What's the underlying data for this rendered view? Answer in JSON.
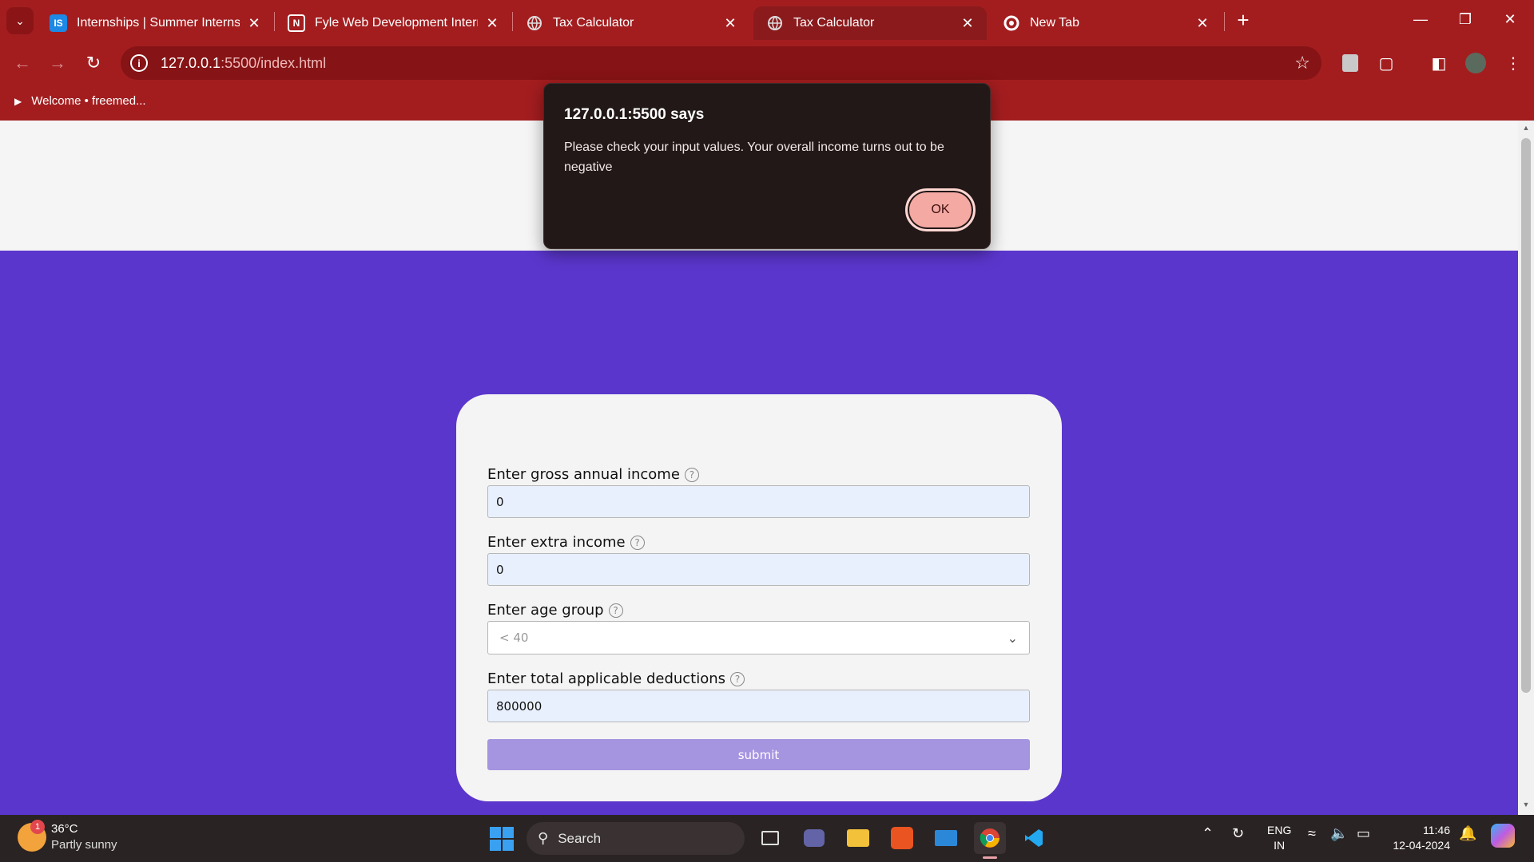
{
  "browser": {
    "tabs": [
      {
        "title": "Internships | Summer Internship",
        "favicon": "IS"
      },
      {
        "title": "Fyle Web Development Internship",
        "favicon": "N"
      },
      {
        "title": "Tax Calculator",
        "favicon": "globe-icon"
      },
      {
        "title": "Tax Calculator",
        "favicon": "globe-icon"
      },
      {
        "title": "New Tab",
        "favicon": "chrome-icon"
      }
    ],
    "active_tab_index": 3,
    "url_host": "127.0.0.1",
    "url_rest": ":5500/index.html",
    "bookmark": "Welcome • freemed...",
    "accent_color": "#a31d1f"
  },
  "dialog": {
    "title": "127.0.0.1:5500 says",
    "message": "Please check your input values. Your overall income turns out to be negative",
    "ok_label": "OK"
  },
  "form": {
    "gross_label": "Enter gross annual income",
    "gross_value": "0",
    "extra_label": "Enter extra income",
    "extra_value": "0",
    "age_label": "Enter age group",
    "age_value": "< 40",
    "deductions_label": "Enter total applicable deductions",
    "deductions_value": "800000",
    "submit_label": "submit",
    "help_glyph": "?",
    "page_bg_color": "#5b36cd"
  },
  "taskbar": {
    "temperature": "36°C",
    "weather": "Partly sunny",
    "weather_badge": "1",
    "search_label": "Search",
    "lang_1": "ENG",
    "lang_2": "IN",
    "time": "11:46",
    "date": "12-04-2024"
  }
}
